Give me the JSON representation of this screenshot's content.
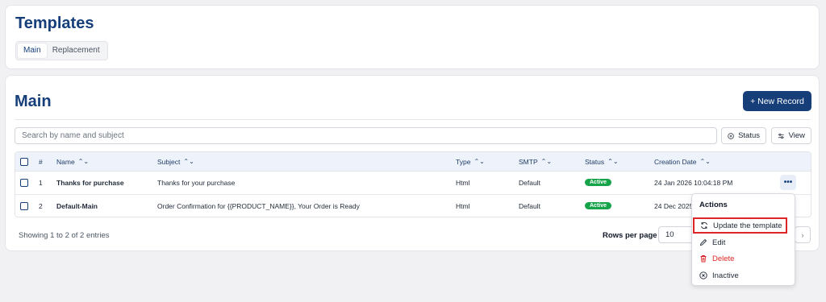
{
  "header": {
    "title": "Templates",
    "tabs": [
      {
        "label": "Main"
      },
      {
        "label": "Replacement"
      }
    ]
  },
  "main": {
    "title": "Main",
    "new_button": "+ New Record",
    "search_placeholder": "Search by name and subject",
    "status_button": "Status",
    "view_button": "View",
    "columns": [
      "#",
      "Name",
      "Subject",
      "Type",
      "SMTP",
      "Status",
      "Creation Date"
    ],
    "rows": [
      {
        "num": "1",
        "name": "Thanks for purchase",
        "subject": "Thanks for your purchase",
        "type": "Html",
        "smtp": "Default",
        "status": "Active",
        "date": "24 Jan 2026 10:04:18 PM"
      },
      {
        "num": "2",
        "name": "Default-Main",
        "subject": "Order Confirmation for {{PRODUCT_NAME}}, Your Order is Ready",
        "type": "Html",
        "smtp": "Default",
        "status": "Active",
        "date": "24 Dec 2025"
      }
    ],
    "footer_text": "Showing 1 to 2 of 2 entries",
    "rows_per_page_label": "Rows per page",
    "rows_per_page_value": "10",
    "status_color": "#16a34a",
    "accent_color": "#163f7a"
  },
  "actions_menu": {
    "title": "Actions",
    "items": [
      {
        "label": "Update the template",
        "icon": "refresh-icon"
      },
      {
        "label": "Edit",
        "icon": "pencil-icon"
      },
      {
        "label": "Delete",
        "icon": "trash-icon"
      },
      {
        "label": "Inactive",
        "icon": "x-circle-icon"
      }
    ],
    "row_menu_button": "•••"
  }
}
